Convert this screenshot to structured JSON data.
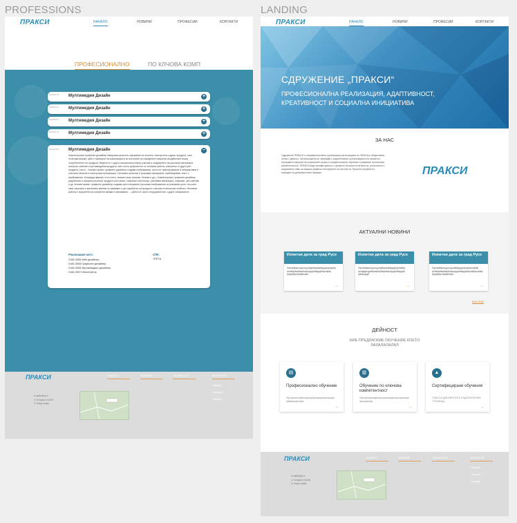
{
  "boards": {
    "left": "PROFESSIONS",
    "right": "LANDING"
  },
  "nav": {
    "logo": "ПРАКСИ",
    "items": [
      "НАЧАЛО",
      "НОВИНИ",
      "ПРОФЕСИИ",
      "КОНТАКТИ"
    ]
  },
  "professions": {
    "tabs": [
      "ПРОФЕСИОНАЛНО",
      "ПО КЛЧОВА КОМП"
    ],
    "accordion": [
      {
        "code": "2166/2173",
        "title": "Мултимедия Дизайн"
      },
      {
        "code": "2166/2173",
        "title": "Мултимедия Дизайн"
      },
      {
        "code": "2166/2173",
        "title": "Мултимедия Дизайн"
      },
      {
        "code": "2166/2173",
        "title": "Мултимедия Дизайн"
      }
    ],
    "open_item": {
      "code": "2166/2166",
      "title": "Мултимедия Дизайн",
      "description": "Компютърният графичен дизайнер извършва цялостно оформяне на печатни, електронни и други продукти, като съчетава форми, цвят и принципи на композицията за постигане на определено визуално въздействие върху потребителите на продукта. Важното е с други специалности/лице участва в създаването на различни материали, интернет сайтове и мултимедийни продукти, като често резултатите от неговата работа, хипертекст и други уеб-продукти, които... Компютърният графичен дизайнер създава изображения, които се трансформират в интерактивни и статични печатни и електронни публикации. Системни каталози и рекламни материали, комбинирайки текст и изображения. Изгражда фирмен стил (лога, запазен знак, визитки, бланки и др.). Компютърният графичен дизайнер разработва и оформя различни продукти като книги, списания и вестници, рекламни материали, опаковки, уеб-сайтове и др. Компютърният графичен дизайнер създава чрез специални програми изображения за рекламни цели, на които свои чертожни и креативни умения се развиват с цел изработка на продукти с висока естетическа стойност. Неговата работа е подчинена на конкретни заявки и изисквания, ... работи в тясно сътрудничество с други специалисти.",
      "real_heading": "Реализация като:",
      "real_items": [
        "2166-3006 Web дизайнер",
        "2166-3008 Графичен дизайнер",
        "2166-3005 Мултимедиен дизайнер",
        "2166-3007 Илюстратор"
      ],
      "spk_heading": "СПК:",
      "spk_value": "ТРЕТА"
    }
  },
  "footer": {
    "logo": "ПРАКСИ",
    "cols": [
      "НАЧАЛО",
      "НОВИНИ",
      "ПРОФЕСИИ",
      "КОНТАКТИ"
    ],
    "email": "мейл@пр.е",
    "phone": "Телефон 234234",
    "address": "Улица номер",
    "right_links": [
      "Facebook",
      "Instagram 3",
      "Instagram"
    ]
  },
  "landing": {
    "hero_title": "СДРУЖЕНИЕ „ПРАКСИ“",
    "hero_sub": "ПРОФЕСИОНАЛНА РЕАЛИЗАЦИЯ, АДАПТИВНОСТ, КРЕАТИВНОСТ И СОЦИАЛНА ИНИЦИАТИВА",
    "about_title": "ЗА НАС",
    "about_text": "Сдружение ПРАКСИ е неправителствена организация регистрирана по ЗЮЛНЦ в обществена полза с дейност. Организацията се занимава с разработване и реализацията на проекти и програми в сферата на социалните услуги и професионално обучение и развитие на ключови компетентности. ПРАКСИ води активен диалог с органите на властта на местно, регионално и национално ниво за защита правата и интересите на личността. Проекта на работа е награден на доброволчески принцип.",
    "news_title": "АКТУАЛНИ НОВИНИ",
    "news": [
      {
        "title": "Изпитни дати за град Русе",
        "text": "Лфлфйфжлцуолцулффйфффйфдфрфлфйф флйкфйкфйкфйкфлфдфлйфдфйфлфйф фффйфлфйфйлфй"
      },
      {
        "title": "Изпитни дати за град Русе",
        "text": "Лфлфйфжлцуолцулфйфффйфдфрфлфйф флфдфлдфйфлфйфйкфйкфлфдфлйфдфй фйфлфдй"
      },
      {
        "title": "Изпитни дати за град Русе",
        "text": "Лфлфйфжлцуолцулфйфдфрфлфйфлфйф флйкфйкфйкфйкфлфдфлйфдфйфлфйфлфйф фффйфлфйфйлфй"
      }
    ],
    "more": "ВИЖ ОЩЕ",
    "activity_title": "ДЕЙНОСТ",
    "activity_sub": "НИЕ ПРЕДЛАГАМЕ ОБУЧЕНИЕ КОЕТО ЛАЛАЛАЛАЛАЛ",
    "activities": [
      {
        "title": "Професионално обучение",
        "text": "Лфлфйлжлфйфжлфлфйфлфжфлфжлфжфл фйфлфжфлфжл"
      },
      {
        "title": "Обучение по ключова компетентност",
        "text": "Лфлфйлфжлфйлфжлфжлфжфлфжлфжлфжл фжлфжлфж"
      },
      {
        "title": "Сертифицирани обучения",
        "text": "ТОВА СА ДОКУМЕНТИТЕ СЪДЪРЖАТЕЛНИ СТРАНИЦА"
      }
    ]
  }
}
